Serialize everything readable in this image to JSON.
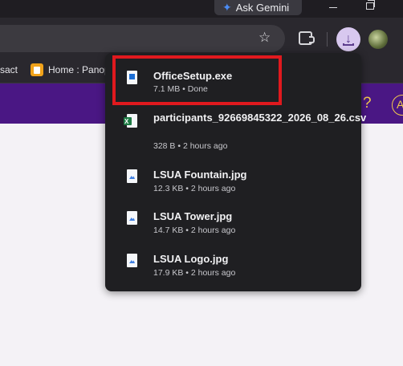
{
  "browser": {
    "gemini_label": "Ask Gemini",
    "bookmarks": [
      {
        "label": "sact"
      },
      {
        "label": "Home : Panop"
      }
    ]
  },
  "page_header": {
    "help_glyph": "?",
    "account_initial": "A"
  },
  "downloads": {
    "items": [
      {
        "name": "OfficeSetup.exe",
        "meta": "7.1 MB • Done",
        "icon": "exe-file-icon"
      },
      {
        "name": "participants_92669845322_2026_08_26.csv",
        "meta": "328 B • 2 hours ago",
        "icon": "excel-csv-icon"
      },
      {
        "name": "LSUA Fountain.jpg",
        "meta": "12.3 KB • 2 hours ago",
        "icon": "image-file-icon"
      },
      {
        "name": "LSUA Tower.jpg",
        "meta": "14.7 KB • 2 hours ago",
        "icon": "image-file-icon"
      },
      {
        "name": "LSUA Logo.jpg",
        "meta": "17.9 KB • 2 hours ago",
        "icon": "image-file-icon"
      }
    ]
  },
  "colors": {
    "highlight": "#e0191e",
    "page_header": "#4a1784",
    "download_button": "#d8c8ef"
  }
}
